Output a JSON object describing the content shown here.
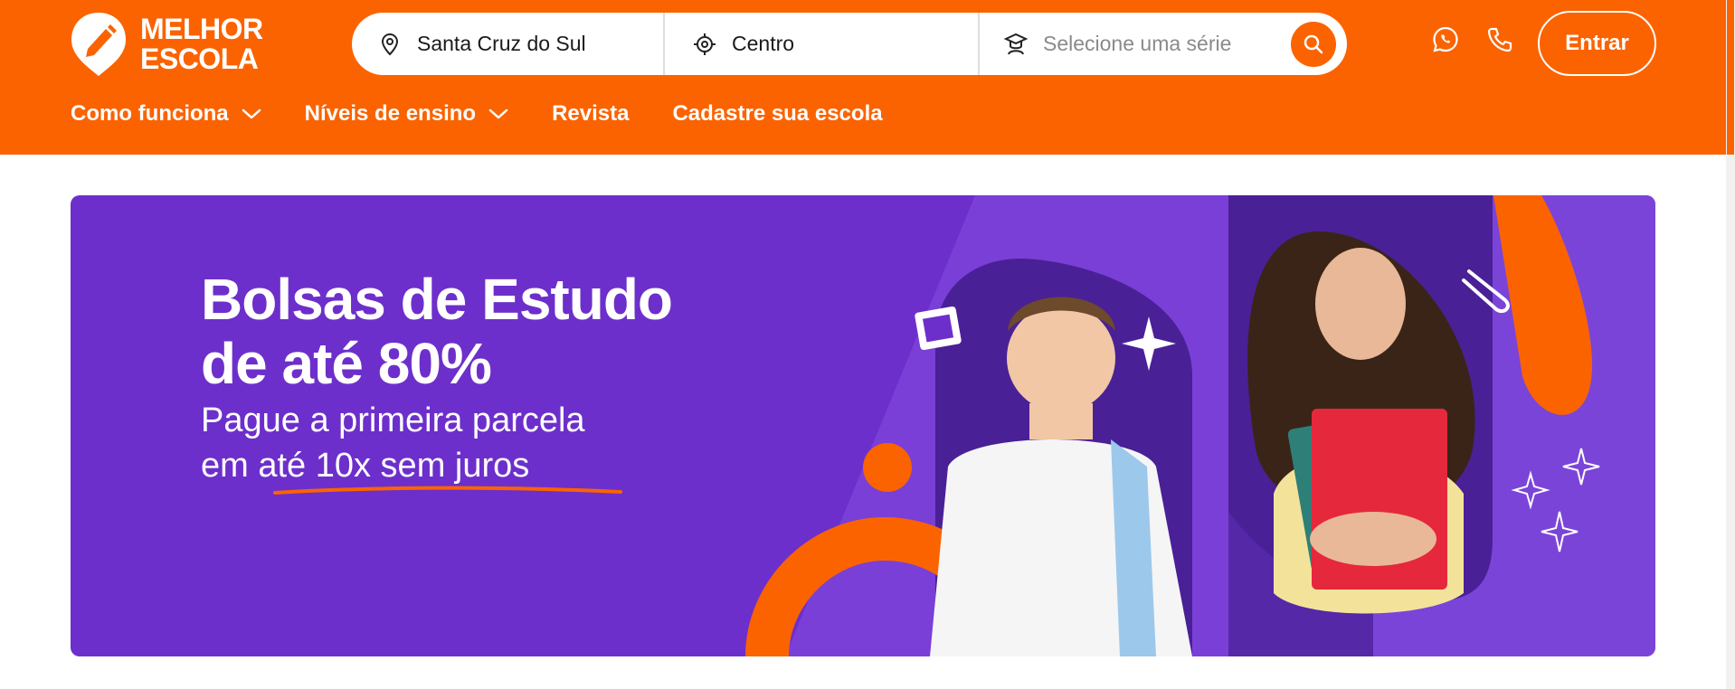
{
  "brand": {
    "line1": "MELHOR",
    "line2": "ESCOLA",
    "accent": "#fb6300"
  },
  "search": {
    "city": "Santa Cruz do Sul",
    "neighborhood": "Centro",
    "grade_placeholder": "Selecione uma série",
    "city_icon": "map-pin-icon",
    "neighborhood_icon": "target-icon",
    "grade_icon": "student-icon",
    "button_icon": "search-icon"
  },
  "header_actions": {
    "whatsapp_icon": "whatsapp-icon",
    "phone_icon": "phone-icon",
    "login_label": "Entrar"
  },
  "nav": {
    "items": [
      {
        "label": "Como funciona",
        "has_dropdown": true
      },
      {
        "label": "Níveis de ensino",
        "has_dropdown": true
      },
      {
        "label": "Revista",
        "has_dropdown": false
      },
      {
        "label": "Cadastre sua escola",
        "has_dropdown": false
      }
    ]
  },
  "banner": {
    "headline_line1": "Bolsas de Estudo",
    "headline_line2": "de até 80%",
    "sub_line1": "Pague a primeira parcela",
    "sub_line2": "em até 10x sem juros",
    "background": "#6d2fcb"
  }
}
